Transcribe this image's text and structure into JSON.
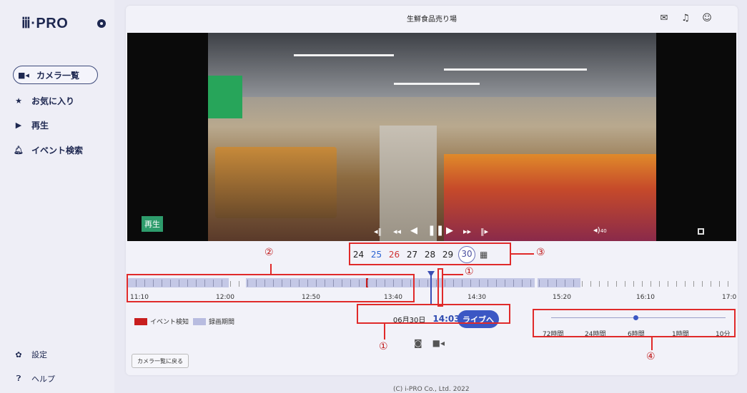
{
  "brand": {
    "logo": "ⅲ·PRO"
  },
  "sidebar": {
    "items": [
      {
        "label": "カメラ一覧",
        "icon": "camera-icon"
      },
      {
        "label": "お気に入り",
        "icon": "star-icon"
      },
      {
        "label": "再生",
        "icon": "play-icon"
      },
      {
        "label": "イベント検索",
        "icon": "bell-icon"
      }
    ],
    "bottom": [
      {
        "label": "設定",
        "icon": "gear-icon"
      },
      {
        "label": "ヘルプ",
        "icon": "help-icon"
      }
    ]
  },
  "header": {
    "title": "生鮮食品売り場",
    "icons": [
      "mail-icon",
      "bell-icon",
      "user-icon"
    ]
  },
  "video": {
    "mode_badge": "再生",
    "volume_value": "40",
    "controls": [
      "step-back-icon",
      "rewind-icon",
      "play-reverse-icon",
      "pause-icon",
      "play-icon",
      "fast-forward-icon",
      "step-forward-icon"
    ]
  },
  "dates": [
    {
      "label": "24",
      "style": "normal"
    },
    {
      "label": "25",
      "style": "blue"
    },
    {
      "label": "26",
      "style": "red"
    },
    {
      "label": "27",
      "style": "normal"
    },
    {
      "label": "28",
      "style": "normal"
    },
    {
      "label": "29",
      "style": "normal"
    },
    {
      "label": "30",
      "style": "selected"
    }
  ],
  "timeline": {
    "labels": [
      "11:10",
      "12:00",
      "12:50",
      "13:40",
      "14:30",
      "15:20",
      "16:10",
      "17:0"
    ]
  },
  "legend": {
    "event": "イベント検知",
    "recording": "録画期間",
    "event_color": "#c81e1e",
    "recording_color": "#b8bce0"
  },
  "current": {
    "date": "06月30日",
    "time": "14:03:54",
    "live_button": "ライブへ"
  },
  "zoom": {
    "labels": [
      "72時間",
      "24時間",
      "6時間",
      "1時間",
      "10分"
    ],
    "selected": "6時間"
  },
  "back_button": "カメラ一覧に戻る",
  "annotations": {
    "n1": "①",
    "n2": "②",
    "n3": "③",
    "n4": "④"
  },
  "copyright": "(C) i-PRO Co., Ltd. 2022"
}
